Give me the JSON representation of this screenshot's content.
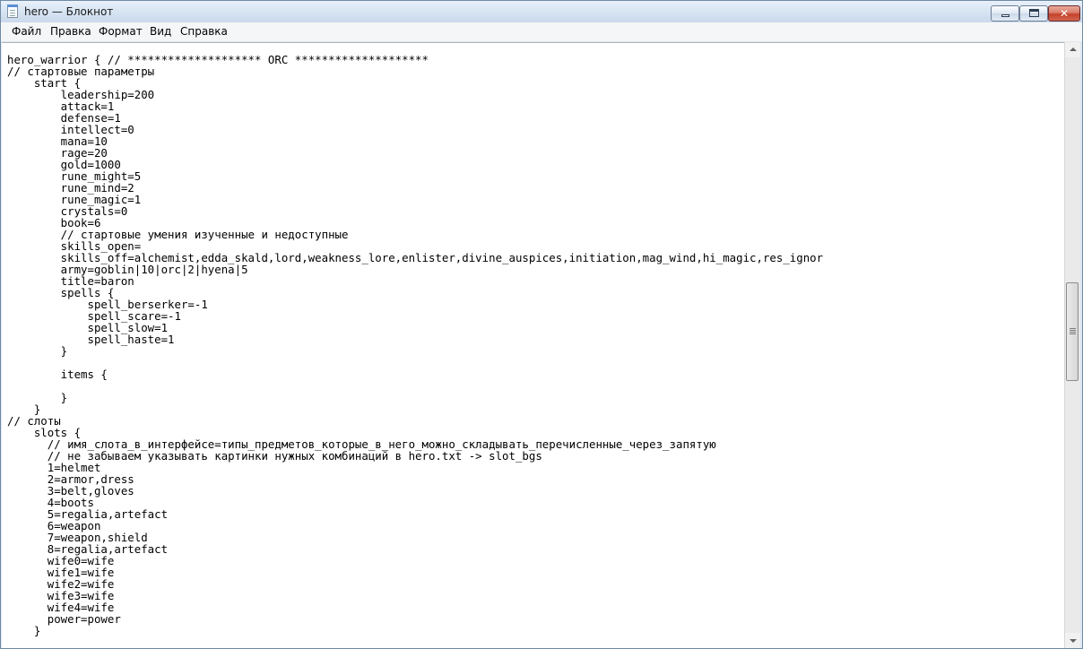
{
  "window": {
    "title": "hero — Блокнот",
    "controls": {
      "minimize_icon": "minimize-icon",
      "maximize_icon": "maximize-icon",
      "close_icon": "close-icon",
      "close_glyph": "✕"
    }
  },
  "menu": {
    "items": [
      {
        "label": "Файл"
      },
      {
        "label": "Правка"
      },
      {
        "label": "Формат"
      },
      {
        "label": "Вид"
      },
      {
        "label": "Справка"
      }
    ]
  },
  "editor": {
    "content": "hero_warrior { // ******************** ORC ********************\n// стартовые параметры\n    start {\n        leadership=200\n        attack=1\n        defense=1\n        intellect=0\n        mana=10\n        rage=20\n        gold=1000\n        rune_might=5\n        rune_mind=2\n        rune_magic=1\n        crystals=0\n        book=6\n        // стартовые умения изученные и недоступные\n        skills_open=\n        skills_off=alchemist,edda_skald,lord,weakness_lore,enlister,divine_auspices,initiation,mag_wind,hi_magic,res_ignor\n        army=goblin|10|orc|2|hyena|5\n        title=baron\n        spells {\n            spell_berserker=-1\n            spell_scare=-1\n            spell_slow=1\n            spell_haste=1\n        }\n\n        items {\n\n        }\n    }\n// слоты\n    slots {\n      // имя_слота_в_интерфейсе=типы_предметов_которые_в_него_можно_складывать_перечисленные_через_запятую\n      // не забываем указывать картинки нужных комбинаций в hero.txt -> slot_bgs\n      1=helmet\n      2=armor,dress\n      3=belt,gloves\n      4=boots\n      5=regalia,artefact\n      6=weapon\n      7=weapon,shield\n      8=regalia,artefact\n      wife0=wife\n      wife1=wife\n      wife2=wife\n      wife3=wife\n      wife4=wife\n      power=power\n    }"
  },
  "scrollbar": {
    "up_icon": "scroll-up-arrow-icon",
    "down_icon": "scroll-down-arrow-icon"
  }
}
